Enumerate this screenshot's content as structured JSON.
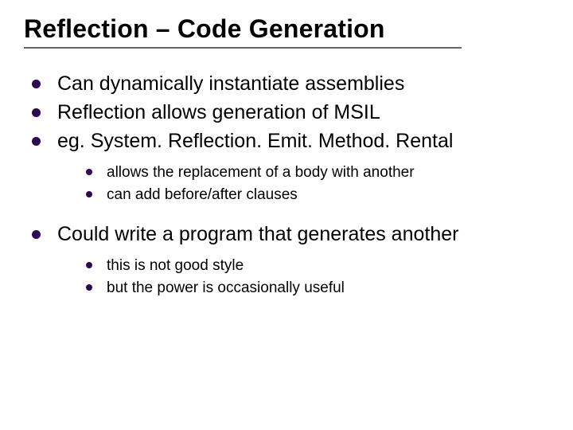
{
  "title": "Reflection – Code Generation",
  "bullets": [
    {
      "text": "Can dynamically instantiate assemblies"
    },
    {
      "text": "Reflection allows generation of MSIL"
    },
    {
      "text": "eg. System. Reflection. Emit. Method. Rental",
      "sub": [
        "allows the replacement of a body with another",
        "can add before/after clauses"
      ]
    },
    {
      "text": "Could write a program that generates another",
      "sub": [
        "this is not good style",
        "but the power is occasionally useful"
      ]
    }
  ]
}
